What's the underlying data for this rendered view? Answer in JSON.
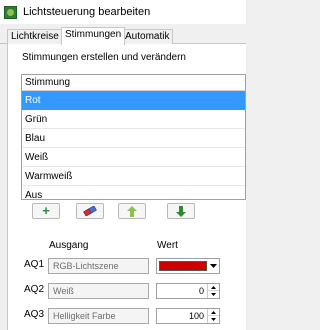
{
  "window": {
    "title": "Lichtsteuerung bearbeiten",
    "icon": "app-icon",
    "accent": "#3399ff"
  },
  "tabs": [
    {
      "label": "Lichtkreise",
      "active": false
    },
    {
      "label": "Stimmungen",
      "active": true
    },
    {
      "label": "Automatik",
      "active": false
    }
  ],
  "stimmungen": {
    "section_label": "Stimmungen erstellen und verändern",
    "list_header": "Stimmung",
    "items": [
      "Rot",
      "Grün",
      "Blau",
      "Weiß",
      "Warmweiß",
      "Aus"
    ],
    "selected_index": 0,
    "toolbar": {
      "add_icon": "plus-icon",
      "delete_icon": "eraser-icon",
      "move_up_icon": "arrow-up-icon",
      "move_down_icon": "arrow-down-icon"
    }
  },
  "outputs": {
    "col_ausgang": "Ausgang",
    "col_wert": "Wert",
    "rows": [
      {
        "label": "AQ1",
        "ausgang": "RGB-Lichtszene",
        "wert_color": "#cc0000"
      },
      {
        "label": "AQ2",
        "ausgang": "Weiß",
        "wert": "0"
      },
      {
        "label": "AQ3",
        "ausgang": "Helligkeit Farbe",
        "wert": "100"
      }
    ]
  }
}
